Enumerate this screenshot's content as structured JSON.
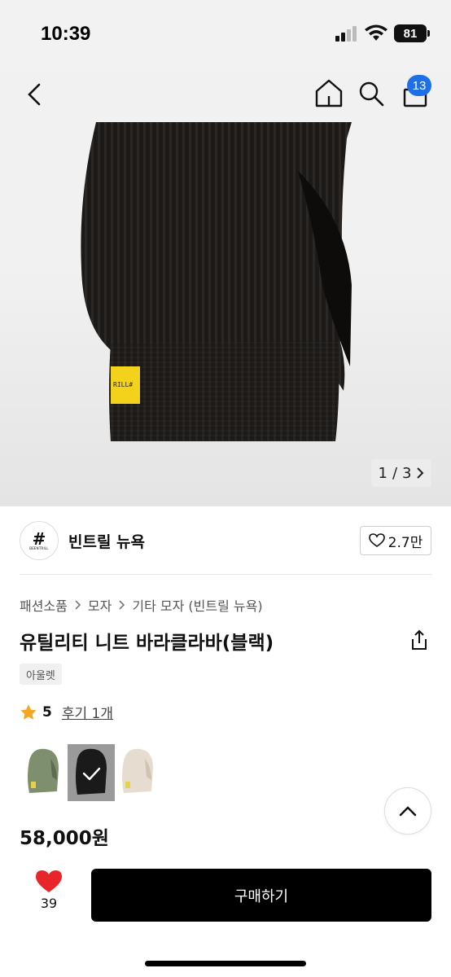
{
  "status_bar": {
    "time": "10:39",
    "battery": "81"
  },
  "header": {
    "back_icon": "chevron-left-icon",
    "home_icon": "home-icon",
    "search_icon": "search-icon",
    "cart_icon": "cart-icon",
    "cart_badge": "13"
  },
  "gallery": {
    "pager": "1/3",
    "pager_current": "1",
    "pager_sep": "/",
    "pager_total": "3"
  },
  "seller": {
    "logo_text": "#",
    "logo_sub": "BEENTRILL",
    "name": "빈트릴 뉴욕",
    "likes": "2.7만"
  },
  "breadcrumb": [
    "패션소품",
    "모자",
    "기타 모자 (빈트릴 뉴욕)"
  ],
  "product": {
    "title": "유틸리티 니트 바라클라바(블랙)",
    "tag": "아울렛",
    "rating": "5",
    "reviews": "후기 1개",
    "price": "58,000원"
  },
  "swatches": [
    {
      "color": "#7d8f6d",
      "selected": false
    },
    {
      "color": "#1a1a1a",
      "selected": true
    },
    {
      "color": "#e6ddd0",
      "selected": false
    }
  ],
  "bottom": {
    "wish_count": "39",
    "buy_label": "구매하기"
  },
  "colors": {
    "accent": "#1f6fe8",
    "heart": "#e8262a",
    "star": "#f5a623",
    "primary_button": "#000000"
  }
}
